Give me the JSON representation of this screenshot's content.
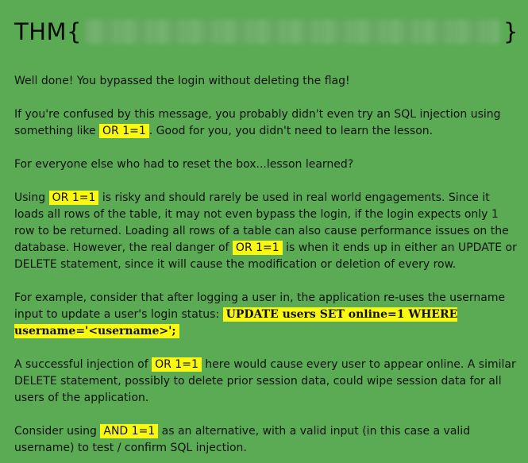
{
  "flag": {
    "prefix": "THM{",
    "suffix": "}"
  },
  "paragraphs": {
    "p1": "Well done! You bypassed the login without deleting the flag!",
    "p2_a": "If you're confused by this message, you probably didn't even try an SQL injection using something like ",
    "p2_code": "OR 1=1",
    "p2_b": ". Good for you, you didn't need to learn the lesson.",
    "p3": "For everyone else who had to reset the box...lesson learned?",
    "p4_a": "Using ",
    "p4_code1": "OR 1=1",
    "p4_b": " is risky and should rarely be used in real world engagements. Since it loads all rows of the table, it may not even bypass the login, if the login expects only 1 row to be returned. Loading all rows of a table can also cause performance issues on the database. However, the real danger of ",
    "p4_code2": "OR 1=1",
    "p4_c": " is when it ends up in either an UPDATE or DELETE statement, since it will cause the modification or deletion of every row.",
    "p5_a": "For example, consider that after logging a user in, the application re-uses the username input to update a user's login status: ",
    "p5_code": "UPDATE users SET online=1 WHERE username='<username>';",
    "p6_a": "A successful injection of ",
    "p6_code": "OR 1=1",
    "p6_b": " here would cause every user to appear online. A similar DELETE statement, possibly to delete prior session data, could wipe session data for all users of the application.",
    "p7_a": "Consider using ",
    "p7_code": "AND 1=1",
    "p7_b": " as an alternative, with a valid input (in this case a valid username) to test / confirm SQL injection."
  }
}
